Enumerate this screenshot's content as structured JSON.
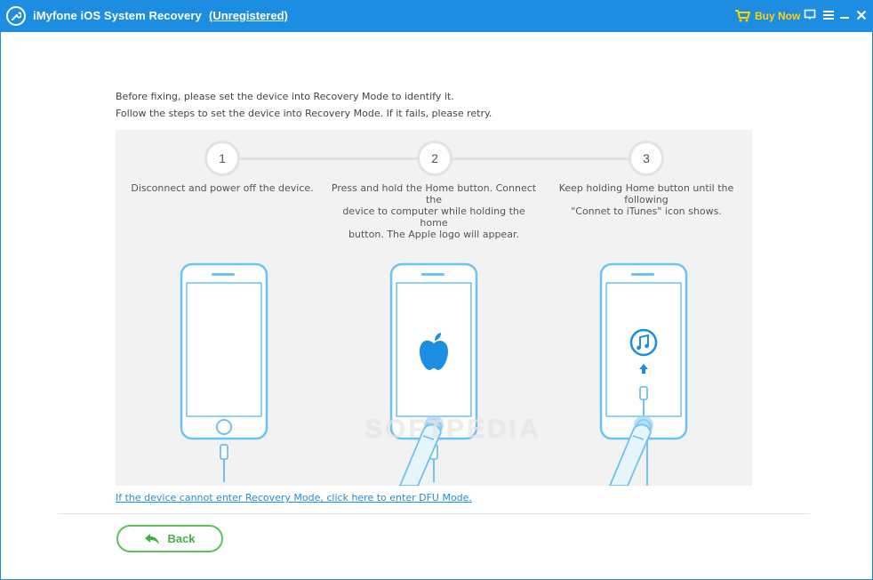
{
  "titlebar": {
    "title": "iMyfone iOS System Recovery",
    "status": "(Unregistered)",
    "buy_now": "Buy Now"
  },
  "instructions": [
    "Before fixing, please set the device into Recovery Mode to identify it.",
    "Follow the steps to set the device into Recovery Mode. If it fails, please retry."
  ],
  "steps": [
    {
      "number": "1",
      "lines": [
        "Disconnect and power off the device."
      ]
    },
    {
      "number": "2",
      "lines": [
        "Press and hold the Home button. Connect the",
        "device to computer while holding the home",
        "button. The Apple logo will appear."
      ]
    },
    {
      "number": "3",
      "lines": [
        "Keep holding Home button until the following",
        "\"Connet to iTunes\" icon shows."
      ]
    }
  ],
  "watermark": "SOFTPEDIA",
  "dfu_link": "If the device cannot enter Recovery Mode, click here to enter DFU Mode.",
  "back_label": "Back",
  "colors": {
    "titlebar": "#1c8de0",
    "buy_now": "#ffd200",
    "phone_outline": "#6cc2f0",
    "back_green": "#5cc15c",
    "link": "#1c8de0"
  },
  "icons": [
    "wrench-icon",
    "cart-icon",
    "feedback-icon",
    "menu-icon",
    "minimize-icon",
    "close-icon",
    "apple-logo-icon",
    "itunes-icon",
    "up-arrow-icon",
    "back-arrow-icon"
  ]
}
